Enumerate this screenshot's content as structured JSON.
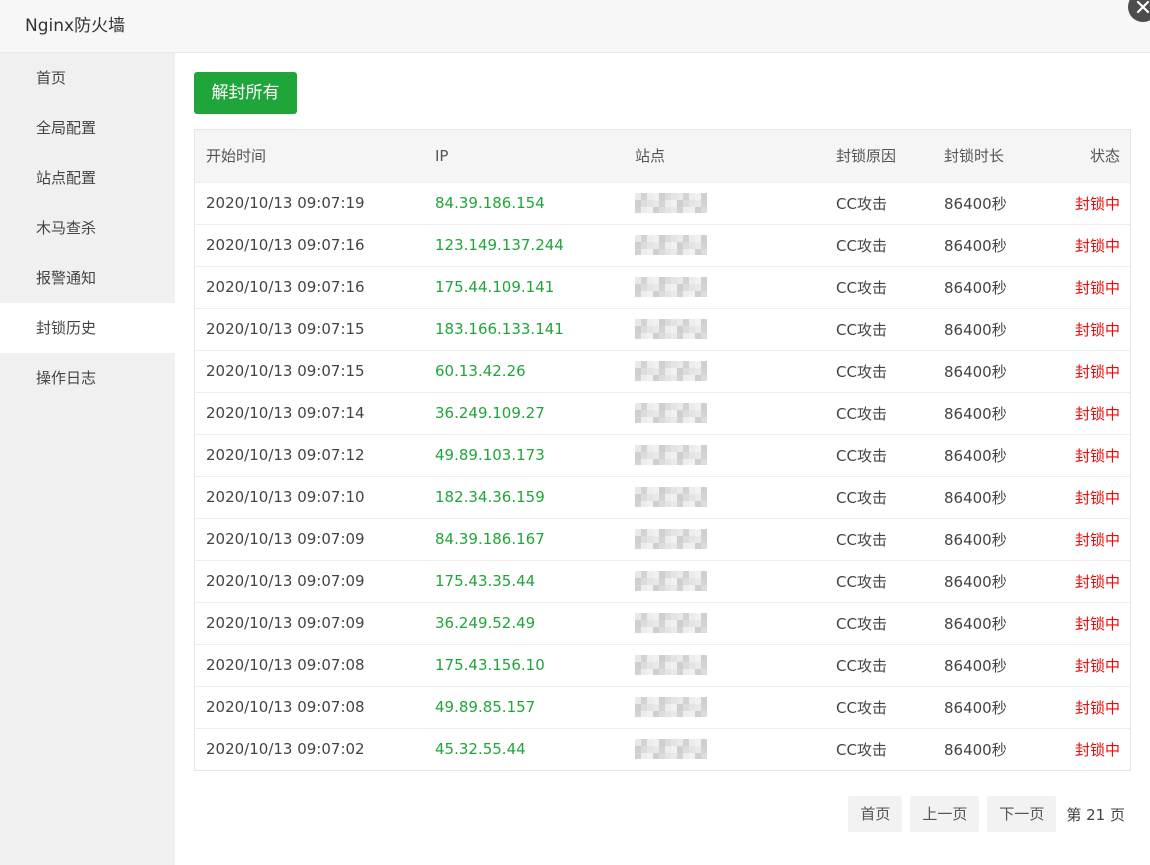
{
  "window": {
    "title": "Nginx防火墙"
  },
  "sidebar": {
    "items": [
      {
        "label": "首页"
      },
      {
        "label": "全局配置"
      },
      {
        "label": "站点配置"
      },
      {
        "label": "木马查杀"
      },
      {
        "label": "报警通知"
      },
      {
        "label": "封锁历史",
        "active": true
      },
      {
        "label": "操作日志"
      }
    ]
  },
  "toolbar": {
    "unblock_all_label": "解封所有"
  },
  "table": {
    "headers": [
      "开始时间",
      "IP",
      "站点",
      "封锁原因",
      "封锁时长",
      "状态"
    ],
    "rows": [
      {
        "time": "2020/10/13 09:07:19",
        "ip": "84.39.186.154",
        "reason": "CC攻击",
        "duration": "86400秒",
        "status": "封锁中"
      },
      {
        "time": "2020/10/13 09:07:16",
        "ip": "123.149.137.244",
        "reason": "CC攻击",
        "duration": "86400秒",
        "status": "封锁中"
      },
      {
        "time": "2020/10/13 09:07:16",
        "ip": "175.44.109.141",
        "reason": "CC攻击",
        "duration": "86400秒",
        "status": "封锁中"
      },
      {
        "time": "2020/10/13 09:07:15",
        "ip": "183.166.133.141",
        "reason": "CC攻击",
        "duration": "86400秒",
        "status": "封锁中"
      },
      {
        "time": "2020/10/13 09:07:15",
        "ip": "60.13.42.26",
        "reason": "CC攻击",
        "duration": "86400秒",
        "status": "封锁中"
      },
      {
        "time": "2020/10/13 09:07:14",
        "ip": "36.249.109.27",
        "reason": "CC攻击",
        "duration": "86400秒",
        "status": "封锁中"
      },
      {
        "time": "2020/10/13 09:07:12",
        "ip": "49.89.103.173",
        "reason": "CC攻击",
        "duration": "86400秒",
        "status": "封锁中"
      },
      {
        "time": "2020/10/13 09:07:10",
        "ip": "182.34.36.159",
        "reason": "CC攻击",
        "duration": "86400秒",
        "status": "封锁中"
      },
      {
        "time": "2020/10/13 09:07:09",
        "ip": "84.39.186.167",
        "reason": "CC攻击",
        "duration": "86400秒",
        "status": "封锁中"
      },
      {
        "time": "2020/10/13 09:07:09",
        "ip": "175.43.35.44",
        "reason": "CC攻击",
        "duration": "86400秒",
        "status": "封锁中"
      },
      {
        "time": "2020/10/13 09:07:09",
        "ip": "36.249.52.49",
        "reason": "CC攻击",
        "duration": "86400秒",
        "status": "封锁中"
      },
      {
        "time": "2020/10/13 09:07:08",
        "ip": "175.43.156.10",
        "reason": "CC攻击",
        "duration": "86400秒",
        "status": "封锁中"
      },
      {
        "time": "2020/10/13 09:07:08",
        "ip": "49.89.85.157",
        "reason": "CC攻击",
        "duration": "86400秒",
        "status": "封锁中"
      },
      {
        "time": "2020/10/13 09:07:02",
        "ip": "45.32.55.44",
        "reason": "CC攻击",
        "duration": "86400秒",
        "status": "封锁中"
      }
    ]
  },
  "pagination": {
    "first_label": "首页",
    "prev_label": "上一页",
    "next_label": "下一页",
    "page_info": "第 21 页"
  },
  "colors": {
    "accent_green": "#20a53a",
    "status_red": "#ef0808",
    "sidebar_bg": "#f0f0f0"
  }
}
